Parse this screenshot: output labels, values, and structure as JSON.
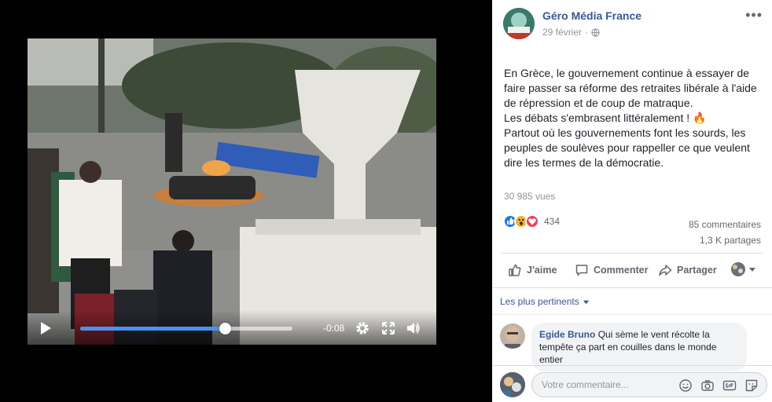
{
  "video": {
    "time_remaining": "-0:08",
    "progress": 0.68,
    "icons": [
      "play-icon",
      "gear-icon",
      "fullscreen-icon",
      "volume-icon"
    ]
  },
  "post": {
    "page_name": "Géro Média France",
    "date": "29 février",
    "privacy_icon": "globe-icon",
    "more_icon": "more-dots-icon",
    "text_lines": [
      "En Grèce, le gouvernement continue à essayer de faire passer sa réforme des retraites libérale à l'aide de répression et de coup de matraque.",
      "Les débats s'embrasent littéralement ! 🔥",
      "Partout où les gouvernements font les sourds, les peuples de soulèves pour rappeller ce que veulent dire les termes de la démocratie."
    ],
    "views": "30 985 vues",
    "reactions_count": "434",
    "reaction_icons": [
      "like-reaction-icon",
      "wow-reaction-icon",
      "love-reaction-icon"
    ],
    "comments_count": "85 commentaires",
    "shares_count": "1,3 K partages",
    "colors": {
      "link": "#385898",
      "muted": "#90949c",
      "like_blue": "#1877f2",
      "love_red": "#f33e58",
      "wow_yellow": "#f7b125"
    }
  },
  "actions": {
    "like": "J'aime",
    "comment": "Commenter",
    "share": "Partager"
  },
  "sort": {
    "label": "Les plus pertinents"
  },
  "comment": {
    "author": "Egide Bruno",
    "text": "Qui sème le vent récolte la tempête ça part en couilles dans le monde entier"
  },
  "composer": {
    "placeholder": "Votre commentaire...",
    "icons": [
      "emoji-icon",
      "camera-icon",
      "gif-icon",
      "sticker-icon"
    ]
  }
}
